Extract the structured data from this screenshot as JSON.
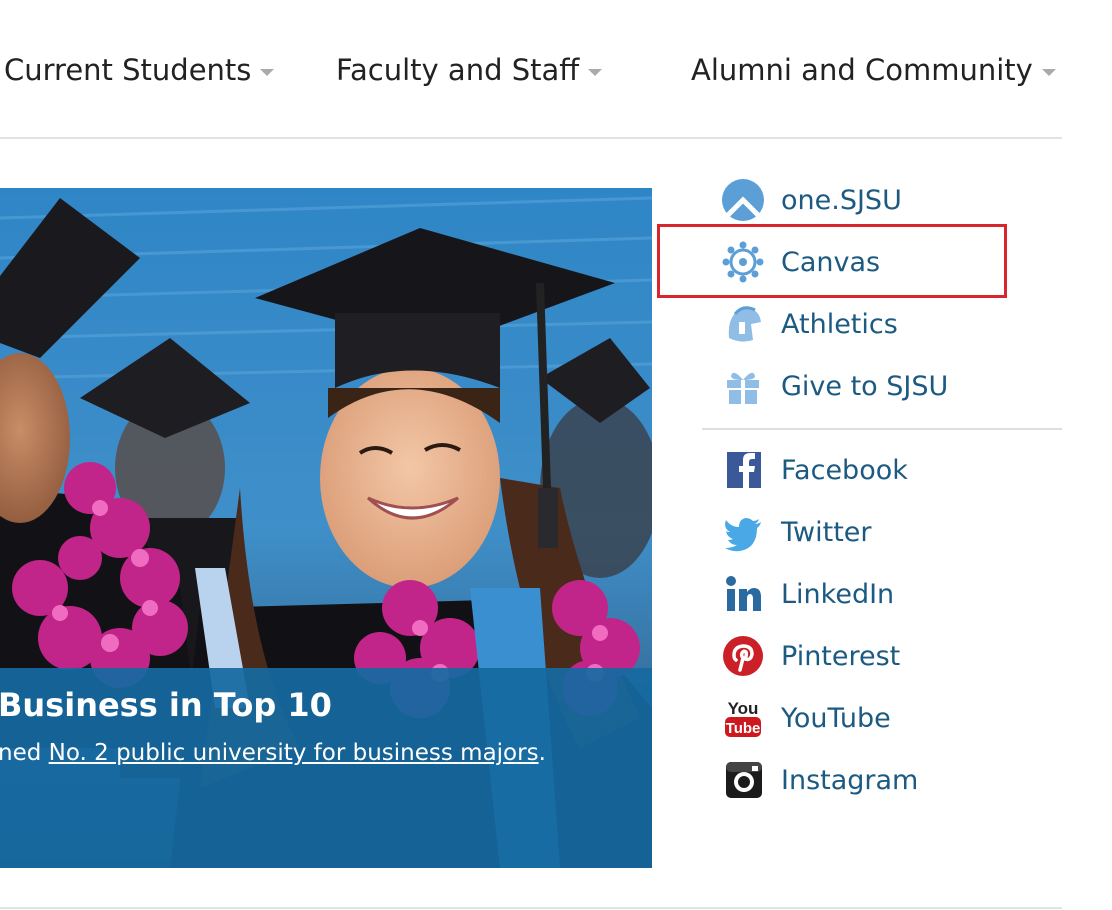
{
  "nav": {
    "items": [
      {
        "label": "Current Students"
      },
      {
        "label": "Faculty and Staff"
      },
      {
        "label": "Alumni and Community"
      }
    ]
  },
  "hero": {
    "title": "Business in Top 10",
    "text_prefix": "ned ",
    "link_text": "No. 2 public university for business majors",
    "text_suffix": "."
  },
  "sidebar": {
    "quick_links": [
      {
        "label": "one.SJSU",
        "icon": "one-sjsu-icon"
      },
      {
        "label": "Canvas",
        "icon": "canvas-icon"
      },
      {
        "label": "Athletics",
        "icon": "spartan-helmet-icon"
      },
      {
        "label": "Give to SJSU",
        "icon": "gift-icon"
      }
    ],
    "social_links": [
      {
        "label": "Facebook",
        "icon": "facebook-icon"
      },
      {
        "label": "Twitter",
        "icon": "twitter-icon"
      },
      {
        "label": "LinkedIn",
        "icon": "linkedin-icon"
      },
      {
        "label": "Pinterest",
        "icon": "pinterest-icon"
      },
      {
        "label": "YouTube",
        "icon": "youtube-icon"
      },
      {
        "label": "Instagram",
        "icon": "instagram-icon"
      }
    ]
  },
  "colors": {
    "link": "#1c5a82",
    "caption_bg": "#1669a0",
    "highlight": "#d9252e"
  }
}
